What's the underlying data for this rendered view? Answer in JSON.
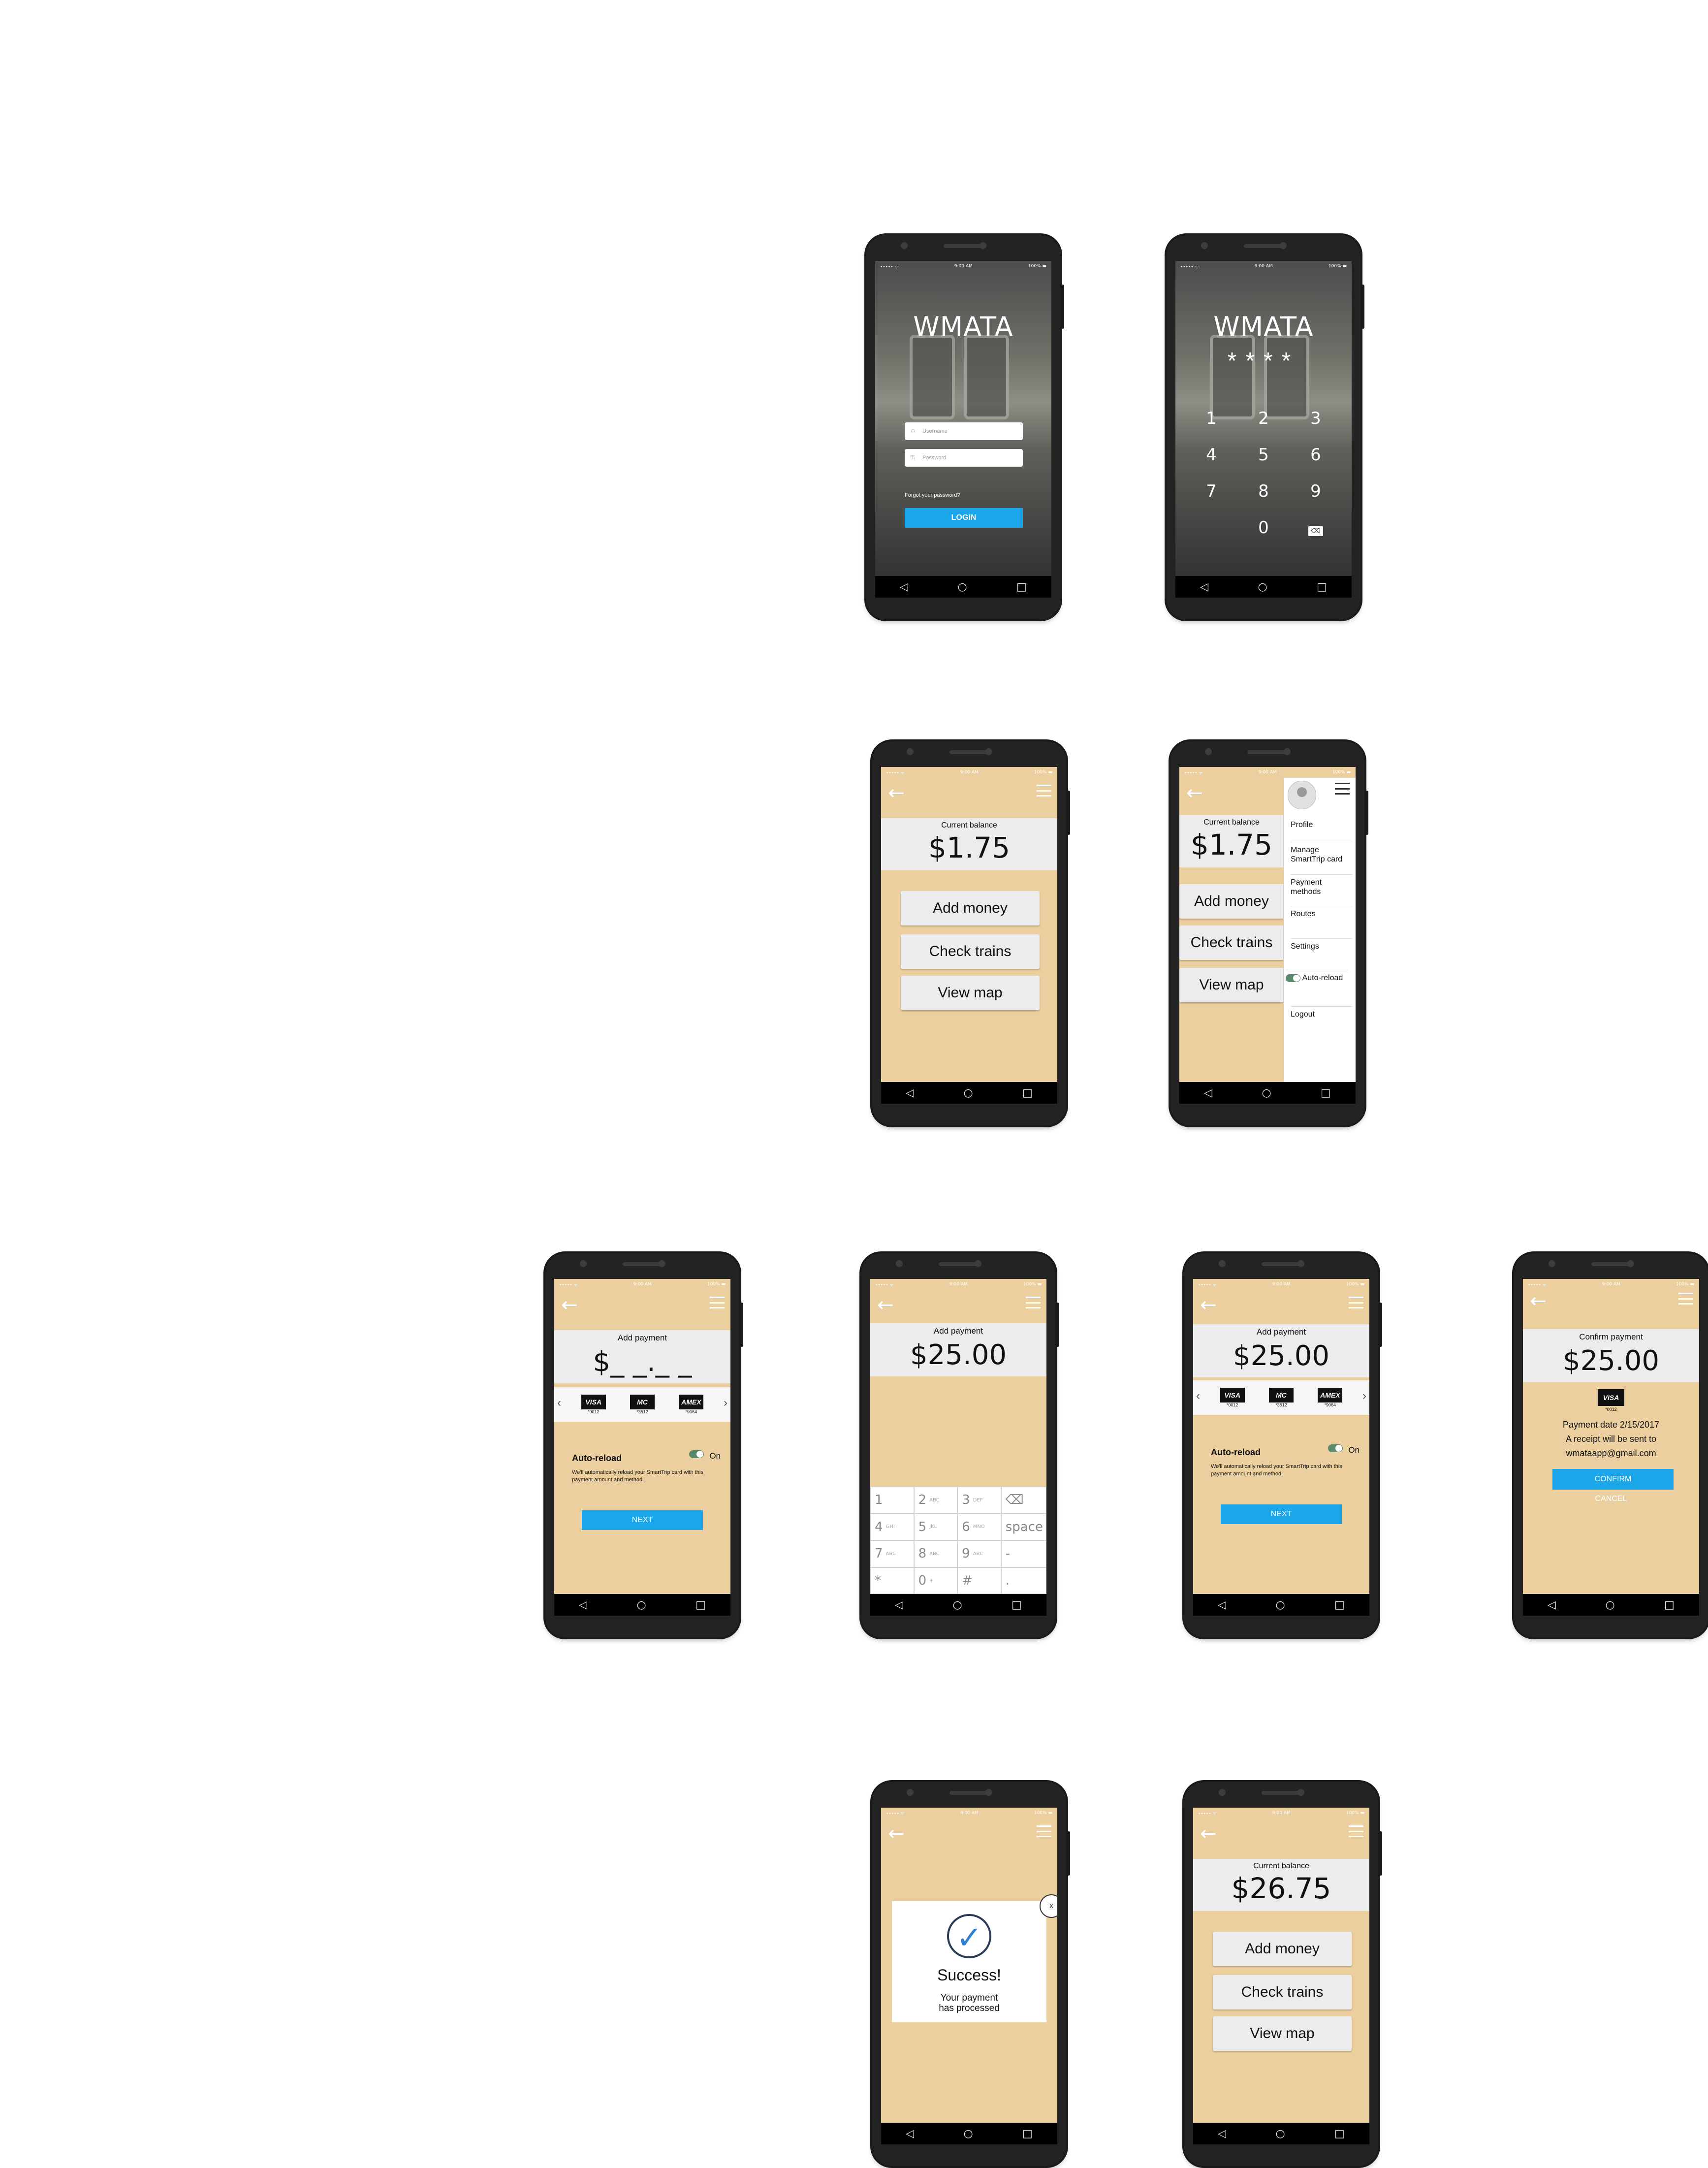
{
  "status": {
    "carrier": "••••• ᯤ",
    "time": "9:00 AM",
    "battery": "100% ▬"
  },
  "nav": {
    "back": "◁",
    "home": "○",
    "recent": "□"
  },
  "login": {
    "brand": "WMATA",
    "username_placeholder": "Username",
    "password_placeholder": "Password",
    "forgot": "Forgot your password?",
    "login_label": "LOGIN"
  },
  "pin": {
    "brand": "WMATA",
    "stars": "****",
    "keys": [
      "1",
      "2",
      "3",
      "4",
      "5",
      "6",
      "7",
      "8",
      "9",
      "",
      "0",
      "⌫"
    ]
  },
  "home1": {
    "balance_label": "Current balance",
    "balance": "$1.75",
    "add_money": "Add money",
    "check_trains": "Check trains",
    "view_map": "View map"
  },
  "drawer": {
    "items": [
      "Profile",
      "Manage SmartTrip card",
      "Payment methods",
      "Routes",
      "Settings",
      "Auto-reload",
      "Logout"
    ]
  },
  "add_payment": {
    "label": "Add payment",
    "amount_blank": "$_ _._ _",
    "amount": "$25.00",
    "cards": [
      {
        "brand": "VISA",
        "num": "*0012"
      },
      {
        "brand": "MC",
        "num": "*3512"
      },
      {
        "brand": "AMEX",
        "num": "*9064"
      }
    ],
    "autoreload": "Auto-reload",
    "on": "On",
    "note": "We'll automatically reload your SmartTrip card with this payment amount and method.",
    "next": "NEXT"
  },
  "numpad": [
    [
      "1",
      ""
    ],
    [
      "2",
      "ABC"
    ],
    [
      "3",
      "DEF"
    ],
    [
      "⌫",
      ""
    ],
    [
      "4",
      "GHI"
    ],
    [
      "5",
      "JKL"
    ],
    [
      "6",
      "MNO"
    ],
    [
      "space",
      ""
    ],
    [
      "7",
      "ABC"
    ],
    [
      "8",
      "ABC"
    ],
    [
      "9",
      "ABC"
    ],
    [
      "-",
      ""
    ],
    [
      "*",
      ""
    ],
    [
      "0",
      "+"
    ],
    [
      "#",
      ""
    ],
    [
      ".",
      ""
    ]
  ],
  "confirm": {
    "label": "Confirm payment",
    "amount": "$25.00",
    "card_brand": "VISA",
    "card_num": "*0012",
    "date": "Payment date 2/15/2017",
    "receipt": "A receipt will be sent to",
    "email": "wmataapp@gmail.com",
    "confirm": "CONFIRM",
    "cancel": "CANCEL"
  },
  "success": {
    "title": "Success!",
    "sub1": "Your payment",
    "sub2": "has processed",
    "close": "x",
    "check": "✓"
  },
  "home2": {
    "balance_label": "Current balance",
    "balance": "$26.75",
    "add_money": "Add money",
    "check_trains": "Check trains",
    "view_map": "View map"
  },
  "colors": {
    "accent": "#1aa6e8",
    "background": "#eccf9f",
    "toggle": "#5a8a6b"
  }
}
